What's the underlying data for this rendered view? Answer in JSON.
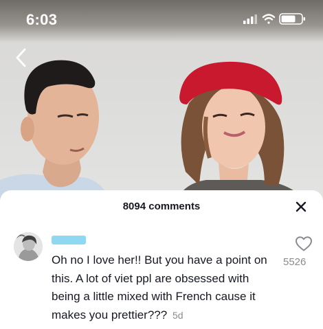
{
  "status_bar": {
    "time": "6:03",
    "icons": [
      "signal-icon",
      "wifi-icon",
      "battery-icon"
    ]
  },
  "video": {
    "back_icon": "chevron-left-icon"
  },
  "comments_sheet": {
    "title": "8094 comments",
    "close_icon": "close-icon",
    "comments": [
      {
        "avatar_icon": "user-avatar",
        "username_redacted": true,
        "text": "Oh no I love her!! But you have a point on this. A lot of viet ppl are obsessed with being a little mixed with French cause it makes you prettier???",
        "age": "5d",
        "like_icon": "heart-outline-icon",
        "like_count": "5526"
      }
    ]
  },
  "colors": {
    "text_primary": "#161823",
    "text_secondary": "#8a8b91",
    "redaction": "#8fd8f2",
    "beret": "#c8192e"
  }
}
